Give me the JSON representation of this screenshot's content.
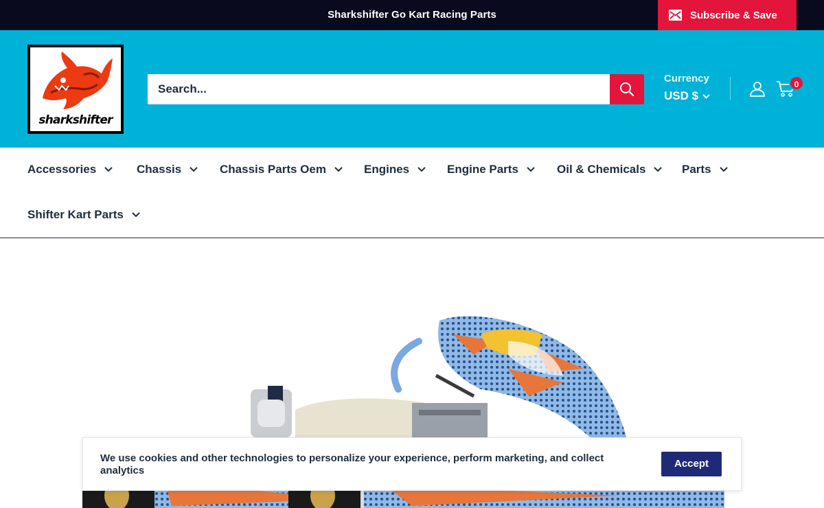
{
  "announcement": {
    "text": "Sharkshifter Go Kart Racing Parts",
    "subscribe_label": "Subscribe & Save",
    "subscribe_icon": "mail-icon"
  },
  "header": {
    "logo_text": "sharkshifter",
    "search_placeholder": "Search...",
    "currency_label": "Currency",
    "currency_value": "USD $",
    "cart_count": "0"
  },
  "nav": {
    "items": [
      {
        "label": "Accessories"
      },
      {
        "label": "Chassis"
      },
      {
        "label": "Chassis Parts Oem"
      },
      {
        "label": "Engines"
      },
      {
        "label": "Engine Parts"
      },
      {
        "label": "Oil & Chemicals"
      },
      {
        "label": "Parts"
      },
      {
        "label": "Shifter Kart Parts"
      }
    ]
  },
  "cookie": {
    "text": "We use cookies and other technologies to personalize your experience, perform marketing, and collect analytics",
    "accept_label": "Accept"
  },
  "colors": {
    "announcement_bg": "#0a0a1f",
    "header_bg": "#00b2d7",
    "accent_red": "#e4153b",
    "accept_bg": "#1e2a78",
    "text_dark": "#1e2d3d"
  }
}
